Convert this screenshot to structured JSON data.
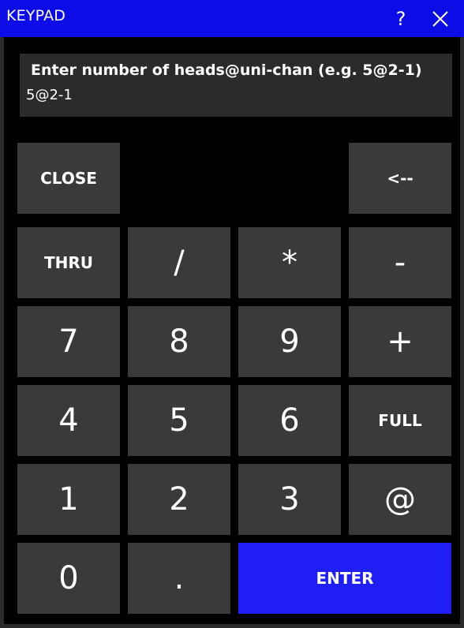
{
  "window": {
    "title": "KEYPAD",
    "help_label": "?",
    "close_icon": "close-icon"
  },
  "prompt": {
    "text": "Enter number of heads@uni-chan  (e.g. 5@2-1)",
    "value": "5@2-1"
  },
  "keys": {
    "close": "CLOSE",
    "backspace": "<--",
    "thru": "THRU",
    "slash": "/",
    "star": "*",
    "minus": "-",
    "seven": "7",
    "eight": "8",
    "nine": "9",
    "plus": "+",
    "four": "4",
    "five": "5",
    "six": "6",
    "full": "FULL",
    "one": "1",
    "two": "2",
    "three": "3",
    "at": "@",
    "zero": "0",
    "dot": ".",
    "enter": "ENTER"
  },
  "colors": {
    "titlebar": "#0c0ce6",
    "key": "#3a3a3a",
    "enter": "#1f1ff5",
    "background": "#000000"
  }
}
